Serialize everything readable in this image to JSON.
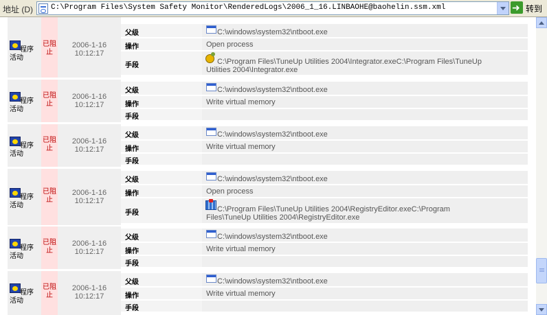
{
  "address_bar": {
    "label": "地址 (D)",
    "url": "C:\\Program Files\\System Safety Monitor\\RenderedLogs\\2006_1_16.LINBAOHE@baohelin.ssm.xml",
    "go_label": "转到"
  },
  "row_labels": {
    "parent": "父级",
    "action": "操作",
    "means": "手段"
  },
  "entries": [
    {
      "type_l1": "程序",
      "type_l2": "活动",
      "status": "已阻止",
      "date": "2006-1-16",
      "time": "10:12:17",
      "parent": "C:\\windows\\system32\\ntboot.exe",
      "action": "Open process",
      "means_line1": "C:\\Program Files\\TuneUp Utilities 2004\\Integrator.exeC:\\Program Files\\TuneUp",
      "means_line2": "Utilities 2004\\Integrator.exe",
      "means_icon": "tuneup-integrator-icon"
    },
    {
      "type_l1": "程序",
      "type_l2": "活动",
      "status": "已阻止",
      "date": "2006-1-16",
      "time": "10:12:17",
      "parent": "C:\\windows\\system32\\ntboot.exe",
      "action": "Write virtual memory",
      "means_line1": "",
      "means_line2": ""
    },
    {
      "type_l1": "程序",
      "type_l2": "活动",
      "status": "已阻止",
      "date": "2006-1-16",
      "time": "10:12:17",
      "parent": "C:\\windows\\system32\\ntboot.exe",
      "action": "Write virtual memory",
      "means_line1": "",
      "means_line2": ""
    },
    {
      "type_l1": "程序",
      "type_l2": "活动",
      "status": "已阻止",
      "date": "2006-1-16",
      "time": "10:12:17",
      "parent": "C:\\windows\\system32\\ntboot.exe",
      "action": "Open process",
      "means_line1": "C:\\Program Files\\TuneUp Utilities 2004\\RegistryEditor.exeC:\\Program",
      "means_line2": "Files\\TuneUp Utilities 2004\\RegistryEditor.exe",
      "means_icon": "registry-editor-icon"
    },
    {
      "type_l1": "程序",
      "type_l2": "活动",
      "status": "已阻止",
      "date": "2006-1-16",
      "time": "10:12:17",
      "parent": "C:\\windows\\system32\\ntboot.exe",
      "action": "Write virtual memory",
      "means_line1": "",
      "means_line2": ""
    },
    {
      "type_l1": "程序",
      "type_l2": "活动",
      "status": "已阻止",
      "date": "2006-1-16",
      "time": "10:12:17",
      "parent": "C:\\windows\\system32\\ntboot.exe",
      "action": "Write virtual memory",
      "means_line1": "",
      "means_line2": ""
    }
  ]
}
